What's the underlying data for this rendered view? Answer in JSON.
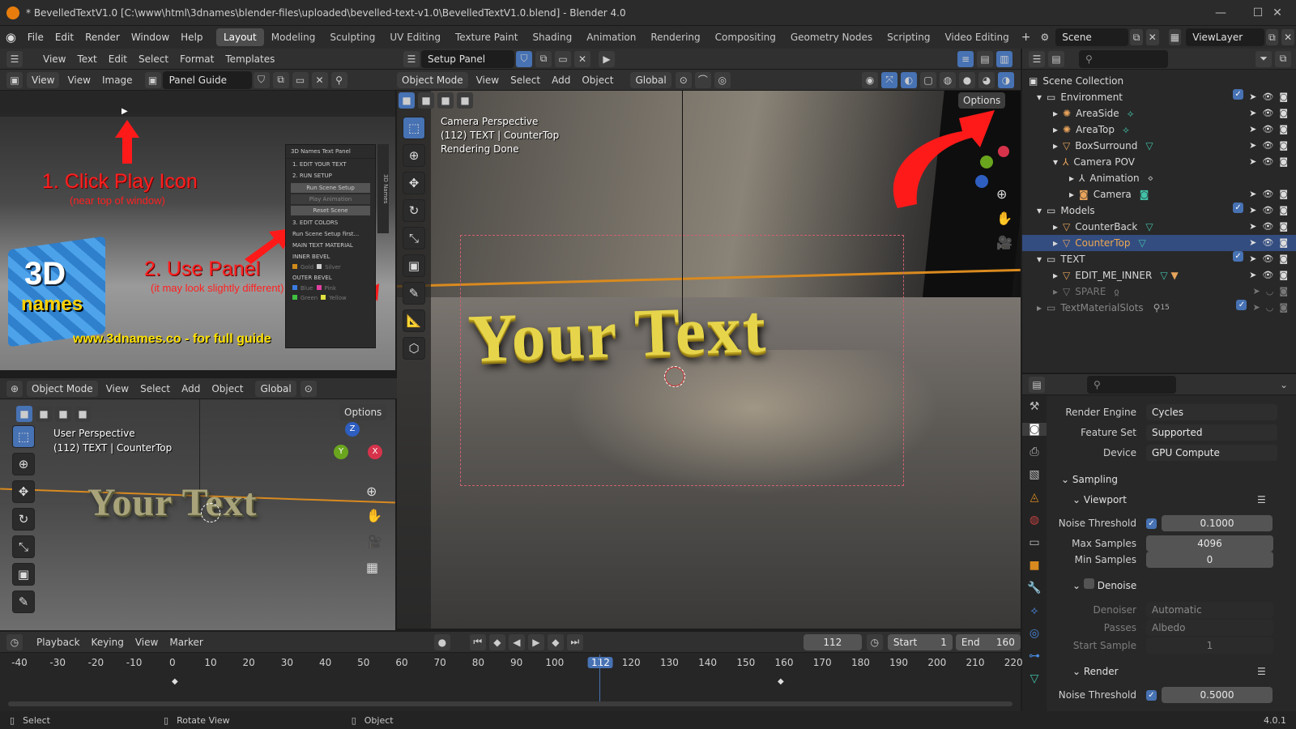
{
  "window": {
    "title": "* BevelledTextV1.0 [C:\\www\\html\\3dnames\\blender-files\\uploaded\\bevelled-text-v1.0\\BevelledTextV1.0.blend] - Blender 4.0",
    "min": "—",
    "max": "☐",
    "close": "✕"
  },
  "menu": [
    "File",
    "Edit",
    "Render",
    "Window",
    "Help"
  ],
  "workspaces": [
    "Layout",
    "Modeling",
    "Sculpting",
    "UV Editing",
    "Texture Paint",
    "Shading",
    "Animation",
    "Rendering",
    "Compositing",
    "Geometry Nodes",
    "Scripting",
    "Video Editing"
  ],
  "scene": "Scene",
  "viewlayer": "ViewLayer",
  "text_editor": {
    "menu": [
      "View",
      "Text",
      "Edit",
      "Select",
      "Format",
      "Templates"
    ],
    "text_name": "Setup Panel"
  },
  "image_editor": {
    "menu": [
      "View",
      "View",
      "Image"
    ],
    "image_name": "Panel Guide"
  },
  "guide": {
    "step1": "1. Click Play Icon",
    "step1_sub": "(near top of window)",
    "step2": "2. Use Panel",
    "step2_sub": "(it may look slightly different)",
    "logo_line1": "3D",
    "logo_line2": "names",
    "url": "www.3dnames.co - for full guide",
    "panel": {
      "title": "3D Names Text Panel",
      "items": [
        "1. EDIT YOUR TEXT",
        "2. RUN SETUP",
        "Run Scene Setup",
        "Play Animation",
        "Reset Scene",
        "3. EDIT COLORS",
        "Run Scene Setup first...",
        "MAIN TEXT MATERIAL",
        "INNER BEVEL",
        "OUTER BEVEL"
      ],
      "swatches": [
        "Gold",
        "Silver",
        "Blue",
        "Pink",
        "Green",
        "Yellow"
      ],
      "side_tab": "3D Names"
    }
  },
  "viewport_main": {
    "mode": "Object Mode",
    "menu": [
      "View",
      "Select",
      "Add",
      "Object"
    ],
    "orientation": "Global",
    "overlay_line1": "Camera Perspective",
    "overlay_line2": "(112) TEXT | CounterTop",
    "overlay_line3": "Rendering Done",
    "render_text": "Your Text",
    "options": "Options"
  },
  "viewport_small": {
    "mode": "Object Mode",
    "menu": [
      "View",
      "Select",
      "Add",
      "Object"
    ],
    "orientation": "Global",
    "options": "Options",
    "overlay_line1": "User Perspective",
    "overlay_line2": "(112) TEXT | CounterTop",
    "render_text": "Your Text",
    "gizmo": {
      "z": "Z",
      "y": "Y",
      "x": "X"
    }
  },
  "outliner": {
    "rows": [
      {
        "label": "Scene Collection",
        "type": "scene"
      },
      {
        "label": "Environment",
        "type": "collection"
      },
      {
        "label": "AreaSide",
        "type": "light"
      },
      {
        "label": "AreaTop",
        "type": "light"
      },
      {
        "label": "BoxSurround",
        "type": "mesh"
      },
      {
        "label": "Camera POV",
        "type": "armature"
      },
      {
        "label": "Animation",
        "type": "action"
      },
      {
        "label": "Camera",
        "type": "camera"
      },
      {
        "label": "Models",
        "type": "collection"
      },
      {
        "label": "CounterBack",
        "type": "mesh"
      },
      {
        "label": "CounterTop",
        "type": "mesh"
      },
      {
        "label": "TEXT",
        "type": "collection"
      },
      {
        "label": "EDIT_ME_INNER",
        "type": "mesh"
      },
      {
        "label": "SPARE",
        "type": "mesh"
      },
      {
        "label": "TextMaterialSlots",
        "type": "collection"
      }
    ],
    "materials_count": "15"
  },
  "properties": {
    "render_engine_label": "Render Engine",
    "render_engine": "Cycles",
    "feature_set_label": "Feature Set",
    "feature_set": "Supported",
    "device_label": "Device",
    "device": "GPU Compute",
    "sampling": "Sampling",
    "viewport": "Viewport",
    "noise_threshold_label": "Noise Threshold",
    "viewport_noise_threshold": "0.1000",
    "max_samples_label": "Max Samples",
    "max_samples": "4096",
    "min_samples_label": "Min Samples",
    "min_samples": "0",
    "denoise": "Denoise",
    "denoiser_label": "Denoiser",
    "denoiser": "Automatic",
    "passes_label": "Passes",
    "passes": "Albedo",
    "start_sample_label": "Start Sample",
    "start_sample": "1",
    "render": "Render",
    "render_noise_threshold": "0.5000"
  },
  "timeline": {
    "menu": [
      "Playback",
      "Keying",
      "View",
      "Marker"
    ],
    "current_frame": "112",
    "start_label": "Start",
    "start": "1",
    "end_label": "End",
    "end": "160",
    "ticks": [
      "-40",
      "-30",
      "-20",
      "-10",
      "0",
      "10",
      "20",
      "30",
      "40",
      "50",
      "60",
      "70",
      "80",
      "90",
      "100",
      "112",
      "120",
      "130",
      "140",
      "150",
      "160",
      "170",
      "180",
      "190",
      "200",
      "210",
      "220"
    ]
  },
  "statusbar": {
    "select": "Select",
    "rotate": "Rotate View",
    "object": "Object",
    "version": "4.0.1"
  },
  "colors": {
    "accent": "#4772b3",
    "blender_orange": "#e87d0d",
    "annotation_red": "#ff1a1a"
  }
}
